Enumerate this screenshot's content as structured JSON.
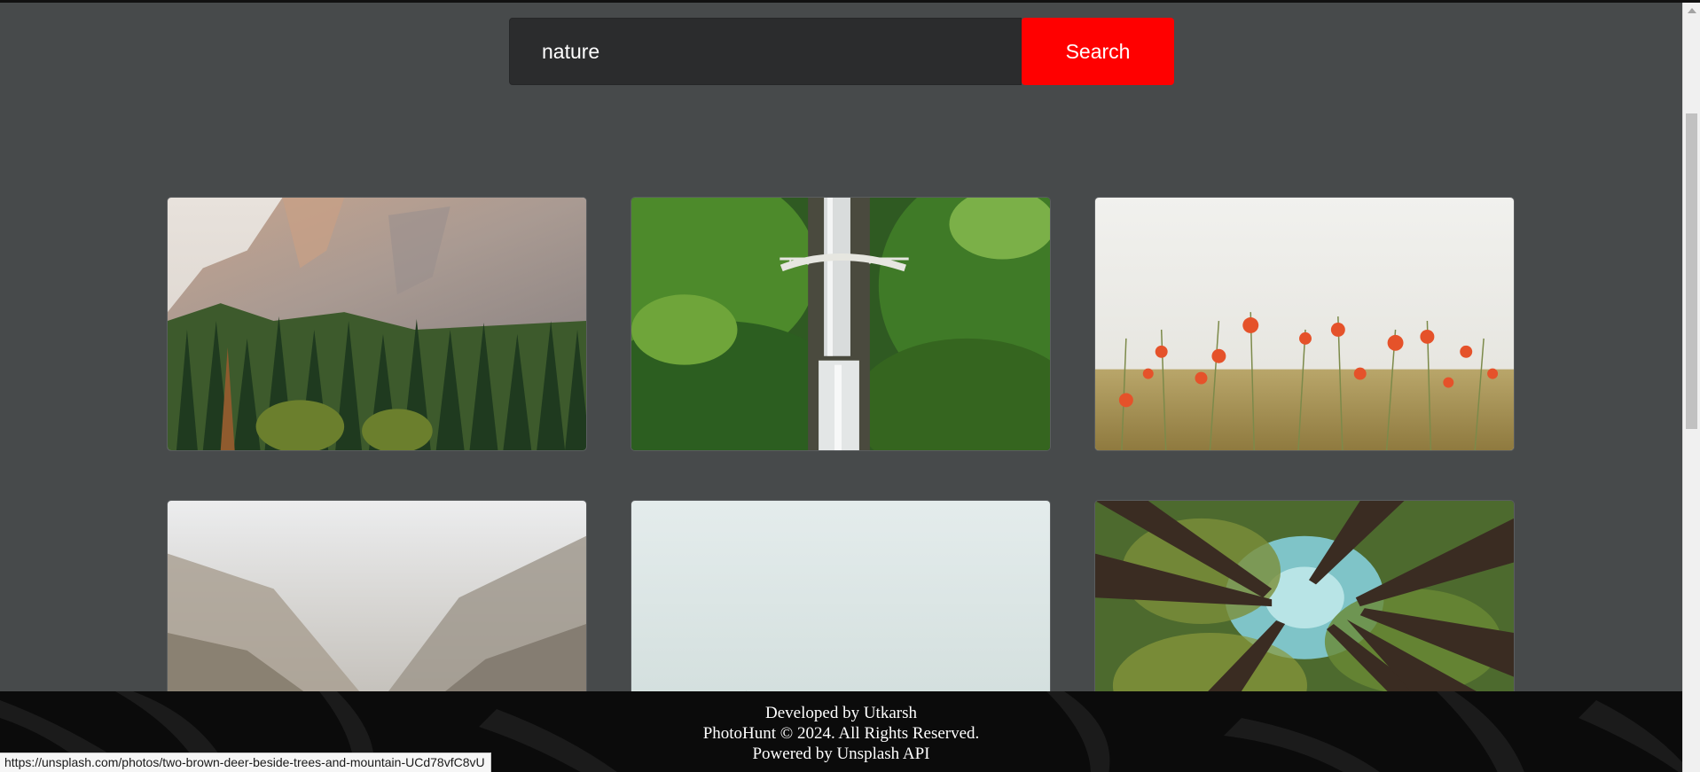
{
  "search": {
    "value": "nature",
    "button_label": "Search"
  },
  "gallery": {
    "images": [
      {
        "subject": "granite-cliff-pine-forest"
      },
      {
        "subject": "waterfall-bridge"
      },
      {
        "subject": "poppy-field"
      },
      {
        "subject": "misty-canyon-river"
      },
      {
        "subject": "foggy-forest"
      },
      {
        "subject": "tree-canopy-looking-up"
      }
    ]
  },
  "footer": {
    "developed_by": "Developed by Utkarsh",
    "copyright": "PhotoHunt © 2024. All Rights Reserved.",
    "powered_by": "Powered by Unsplash API"
  },
  "status_bar": {
    "url": "https://unsplash.com/photos/two-brown-deer-beside-trees-and-mountain-UCd78vfC8vU"
  },
  "colors": {
    "page_background": "#474a4b",
    "search_input_background": "#2b2c2d",
    "search_button": "#ff0000",
    "footer_background": "#0b0b0b"
  }
}
